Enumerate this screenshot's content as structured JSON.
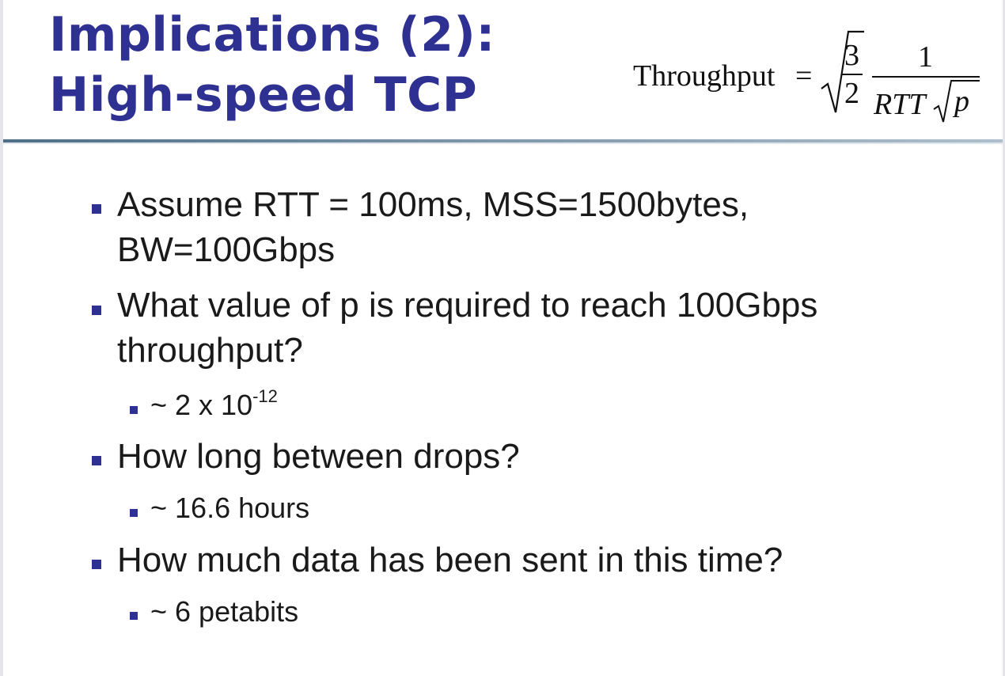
{
  "slide": {
    "title_line1": "Implications (2):",
    "title_line2": "High-speed TCP",
    "formula": {
      "lhs": "Throughput",
      "equals": "=",
      "frac1_num": "3",
      "frac1_den": "2",
      "frac2_num": "1",
      "frac2_den_rtt": "RTT",
      "frac2_den_p": "p"
    },
    "bullets": [
      {
        "line1": "Assume RTT = 100ms, MSS=1500bytes,",
        "line2": "BW=100Gbps"
      },
      {
        "line1": "What value of p is required to reach 100Gbps",
        "line2": "throughput?"
      },
      {
        "text": "How long between drops?"
      },
      {
        "text": "How much data has been sent in this time?"
      }
    ],
    "subbullets": [
      {
        "base": "~ 2 x 10",
        "exponent": "-12"
      },
      {
        "text": "~ 16.6 hours"
      },
      {
        "text": "~ 6 petabits"
      }
    ]
  },
  "colors": {
    "title": "#2e3192",
    "bullet_marker": "#2e3192",
    "rule": "#4f6f86"
  }
}
